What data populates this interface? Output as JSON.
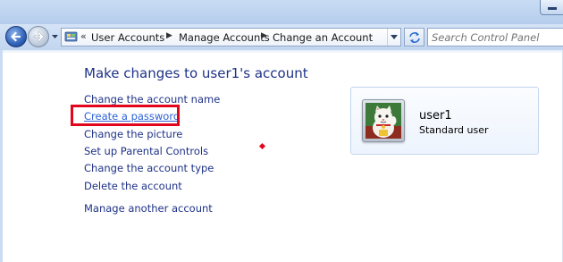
{
  "address_bar": {
    "overflow_chevron": "«",
    "crumbs": [
      "User Accounts",
      "Manage Accounts",
      "Change an Account"
    ],
    "separator": "▶"
  },
  "search": {
    "placeholder": "Search Control Panel"
  },
  "page": {
    "title": "Make changes to user1's account",
    "tasks": [
      {
        "label": "Change the account name"
      },
      {
        "label": "Create a password"
      },
      {
        "label": "Change the picture"
      },
      {
        "label": "Set up Parental Controls"
      },
      {
        "label": "Change the account type"
      },
      {
        "label": "Delete the account"
      }
    ],
    "manage_other": "Manage another account"
  },
  "user": {
    "name": "user1",
    "type": "Standard user"
  },
  "colors": {
    "link": "#1e3287",
    "highlight": "#e2061c",
    "chrome": "#c9dcf4"
  },
  "icons": [
    "back-arrow-icon",
    "forward-arrow-icon",
    "control-panel-icon",
    "refresh-icon",
    "minimize-icon",
    "lucky-cat-icon"
  ]
}
